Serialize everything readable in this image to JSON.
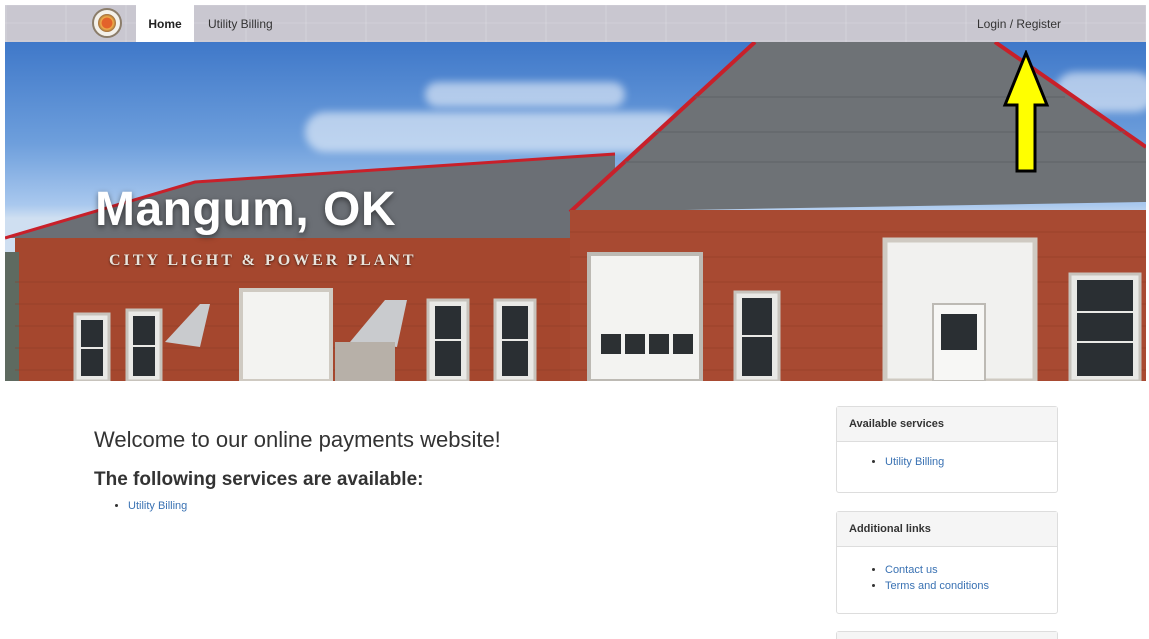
{
  "nav": {
    "logo_icon": "city-seal",
    "home_label": "Home",
    "billing_label": "Utility Billing",
    "login_label": "Login / Register"
  },
  "hero": {
    "title": "Mangum, OK",
    "sign_text": "CITY LIGHT & POWER PLANT"
  },
  "main": {
    "heading": "Welcome to our online payments website!",
    "subheading": "The following services are available:",
    "services": [
      "Utility Billing"
    ]
  },
  "sidebar": {
    "services_panel": {
      "title": "Available services",
      "links": [
        "Utility Billing"
      ]
    },
    "links_panel": {
      "title": "Additional links",
      "links": [
        "Contact us",
        "Terms and conditions"
      ]
    }
  },
  "annotation": {
    "arrow_color": "#ffff00",
    "arrow_icon": "up-arrow-annotation"
  },
  "colors": {
    "link": "#3a72b3",
    "navbar": "#c9c7d0"
  }
}
